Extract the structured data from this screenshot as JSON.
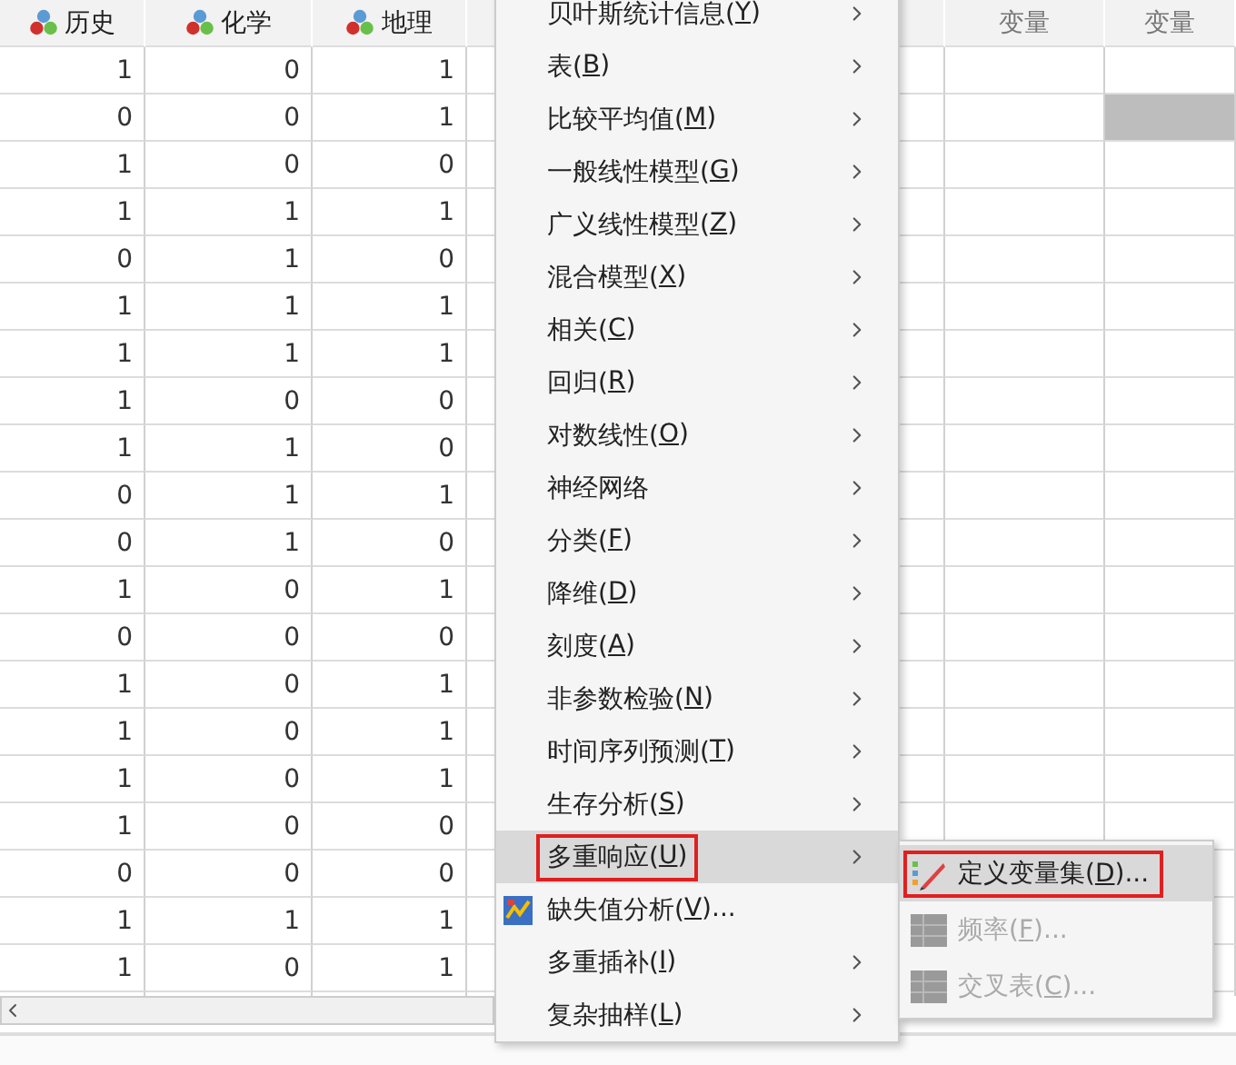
{
  "grid": {
    "columns": [
      {
        "kind": "variable",
        "label": "历史"
      },
      {
        "kind": "variable",
        "label": "化学"
      },
      {
        "kind": "variable",
        "label": "地理"
      },
      {
        "kind": "blank"
      },
      {
        "kind": "blank"
      },
      {
        "kind": "placeholder",
        "label": "变量"
      },
      {
        "kind": "placeholder",
        "label": "变量"
      }
    ],
    "rows": [
      {
        "cells": [
          "1",
          "0",
          "1"
        ],
        "selected": false
      },
      {
        "cells": [
          "0",
          "0",
          "1"
        ],
        "selected": true
      },
      {
        "cells": [
          "1",
          "0",
          "0"
        ],
        "selected": false
      },
      {
        "cells": [
          "1",
          "1",
          "1"
        ],
        "selected": false
      },
      {
        "cells": [
          "0",
          "1",
          "0"
        ],
        "selected": false
      },
      {
        "cells": [
          "1",
          "1",
          "1"
        ],
        "selected": false
      },
      {
        "cells": [
          "1",
          "1",
          "1"
        ],
        "selected": false
      },
      {
        "cells": [
          "1",
          "0",
          "0"
        ],
        "selected": false
      },
      {
        "cells": [
          "1",
          "1",
          "0"
        ],
        "selected": false
      },
      {
        "cells": [
          "0",
          "1",
          "1"
        ],
        "selected": false
      },
      {
        "cells": [
          "0",
          "1",
          "0"
        ],
        "selected": false
      },
      {
        "cells": [
          "1",
          "0",
          "1"
        ],
        "selected": false
      },
      {
        "cells": [
          "0",
          "0",
          "0"
        ],
        "selected": false
      },
      {
        "cells": [
          "1",
          "0",
          "1"
        ],
        "selected": false
      },
      {
        "cells": [
          "1",
          "0",
          "1"
        ],
        "selected": false
      },
      {
        "cells": [
          "1",
          "0",
          "1"
        ],
        "selected": false
      },
      {
        "cells": [
          "1",
          "0",
          "0"
        ],
        "selected": false
      },
      {
        "cells": [
          "0",
          "0",
          "0"
        ],
        "selected": false
      },
      {
        "cells": [
          "1",
          "1",
          "1"
        ],
        "selected": false
      },
      {
        "cells": [
          "1",
          "0",
          "1"
        ],
        "selected": false
      }
    ]
  },
  "menu": {
    "items": [
      {
        "kind": "submenu",
        "label": "贝叶斯统计信息(",
        "key": "Y",
        "after": ")",
        "selected": false
      },
      {
        "kind": "submenu",
        "label": "表(",
        "key": "B",
        "after": ")",
        "selected": false
      },
      {
        "kind": "submenu",
        "label": "比较平均值(",
        "key": "M",
        "after": ")",
        "selected": false
      },
      {
        "kind": "submenu",
        "label": "一般线性模型(",
        "key": "G",
        "after": ")",
        "selected": false
      },
      {
        "kind": "submenu",
        "label": "广义线性模型(",
        "key": "Z",
        "after": ")",
        "selected": false
      },
      {
        "kind": "submenu",
        "label": "混合模型(",
        "key": "X",
        "after": ")",
        "selected": false
      },
      {
        "kind": "submenu",
        "label": "相关(",
        "key": "C",
        "after": ")",
        "selected": false
      },
      {
        "kind": "submenu",
        "label": "回归(",
        "key": "R",
        "after": ")",
        "selected": false
      },
      {
        "kind": "submenu",
        "label": "对数线性(",
        "key": "O",
        "after": ")",
        "selected": false
      },
      {
        "kind": "submenu",
        "label": "神经网络",
        "selected": false
      },
      {
        "kind": "submenu",
        "label": "分类(",
        "key": "F",
        "after": ")",
        "selected": false
      },
      {
        "kind": "submenu",
        "label": "降维(",
        "key": "D",
        "after": ")",
        "selected": false
      },
      {
        "kind": "submenu",
        "label": "刻度(",
        "key": "A",
        "after": ")",
        "selected": false
      },
      {
        "kind": "submenu",
        "label": "非参数检验(",
        "key": "N",
        "after": ")",
        "selected": false
      },
      {
        "kind": "submenu",
        "label": "时间序列预测(",
        "key": "T",
        "after": ")",
        "selected": false
      },
      {
        "kind": "submenu",
        "label": "生存分析(",
        "key": "S",
        "after": ")",
        "selected": false
      },
      {
        "kind": "submenu",
        "label": "多重响应(",
        "key": "U",
        "after": ")",
        "selected": true
      },
      {
        "kind": "dialog",
        "label": "缺失值分析(",
        "key": "V",
        "after": ")...",
        "selected": false
      },
      {
        "kind": "submenu",
        "label": "多重插补(",
        "key": "I",
        "after": ")",
        "selected": false
      },
      {
        "kind": "submenu",
        "label": "复杂抽样(",
        "key": "L",
        "after": ")",
        "selected": false
      }
    ]
  },
  "submenu": {
    "items": [
      {
        "label": "定义变量集(",
        "key": "D",
        "after": ")...",
        "selected": true,
        "disabled": false
      },
      {
        "label": "频率(",
        "key": "F",
        "after": ")...",
        "selected": false,
        "disabled": true
      },
      {
        "label": "交叉表(",
        "key": "C",
        "after": ")...",
        "selected": false,
        "disabled": true
      }
    ]
  }
}
